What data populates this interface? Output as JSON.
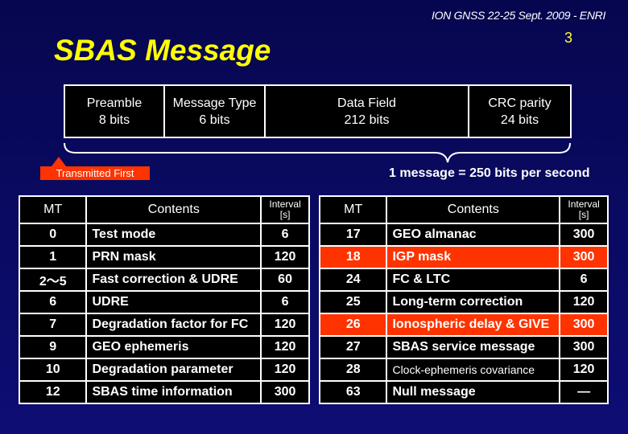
{
  "header": {
    "conference": "ION GNSS 22-25 Sept. 2009 - ENRI",
    "slide_number": "3",
    "title": "SBAS Message"
  },
  "frame": {
    "fields": [
      {
        "name": "Preamble",
        "bits": "8 bits"
      },
      {
        "name": "Message Type",
        "bits": "6 bits"
      },
      {
        "name": "Data Field",
        "bits": "212 bits"
      },
      {
        "name": "CRC parity",
        "bits": "24 bits"
      }
    ],
    "transmitted_first": "Transmitted First",
    "rate_note": "1 message = 250 bits per second"
  },
  "colors": {
    "title": "#ffff00",
    "highlight": "#ff3300",
    "background": "#0a0a62"
  },
  "tables": {
    "headers": {
      "mt": "MT",
      "contents": "Contents",
      "interval": "Interval",
      "interval_unit": "[s]"
    },
    "left": [
      {
        "mt": "0",
        "contents": "Test mode",
        "interval": "6",
        "highlight": false
      },
      {
        "mt": "1",
        "contents": "PRN mask",
        "interval": "120",
        "highlight": false
      },
      {
        "mt": "2～5",
        "contents": "Fast correction & UDRE",
        "interval": "60",
        "highlight": false
      },
      {
        "mt": "6",
        "contents": "UDRE",
        "interval": "6",
        "highlight": false
      },
      {
        "mt": "7",
        "contents": "Degradation factor for FC",
        "interval": "120",
        "highlight": false
      },
      {
        "mt": "9",
        "contents": "GEO ephemeris",
        "interval": "120",
        "highlight": false
      },
      {
        "mt": "10",
        "contents": "Degradation parameter",
        "interval": "120",
        "highlight": false
      },
      {
        "mt": "12",
        "contents": "SBAS time information",
        "interval": "300",
        "highlight": false
      }
    ],
    "right": [
      {
        "mt": "17",
        "contents": "GEO almanac",
        "interval": "300",
        "highlight": false
      },
      {
        "mt": "18",
        "contents": "IGP mask",
        "interval": "300",
        "highlight": true
      },
      {
        "mt": "24",
        "contents": "FC & LTC",
        "interval": "6",
        "highlight": false
      },
      {
        "mt": "25",
        "contents": "Long-term correction",
        "interval": "120",
        "highlight": false
      },
      {
        "mt": "26",
        "contents": "Ionospheric delay & GIVE",
        "interval": "300",
        "highlight": true
      },
      {
        "mt": "27",
        "contents": "SBAS service message",
        "interval": "300",
        "highlight": false
      },
      {
        "mt": "28",
        "contents": "Clock-ephemeris covariance",
        "interval": "120",
        "highlight": false,
        "small": true
      },
      {
        "mt": "63",
        "contents": "Null message",
        "interval": "—",
        "highlight": false
      }
    ]
  }
}
